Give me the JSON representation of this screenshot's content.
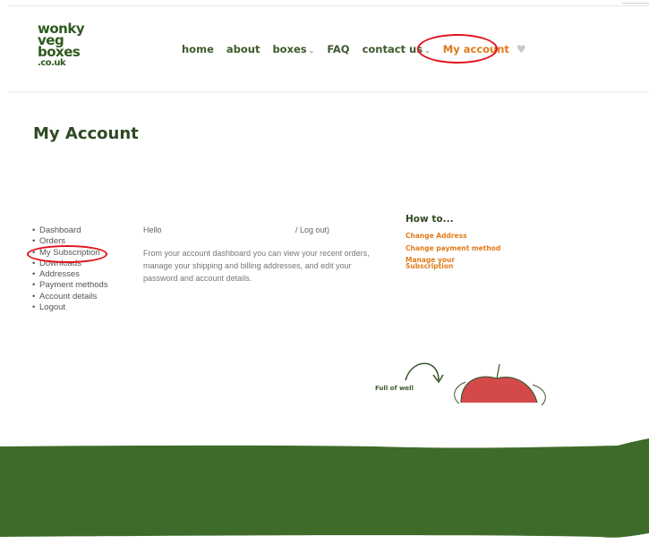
{
  "logo": {
    "line1": "wonky",
    "line2": "veg",
    "line3": "boxes",
    "tld": ".co.uk"
  },
  "nav": {
    "home": "home",
    "about": "about",
    "boxes": "boxes",
    "faq": "FAQ",
    "contact": "contact us",
    "account": "My account",
    "caret": "⌄",
    "heart": "♥"
  },
  "page": {
    "title": "My Account"
  },
  "account_menu": {
    "items": [
      "Dashboard",
      "Orders",
      "My Subscription",
      "Downloads",
      "Addresses",
      "Payment methods",
      "Account details",
      "Logout"
    ]
  },
  "dashboard": {
    "hello": "Hello",
    "logout": "/ Log out)",
    "intro": "From your account dashboard you can view your recent orders, manage your shipping and billing addresses, and edit your password and account details."
  },
  "howto": {
    "title": "How to...",
    "links": [
      "Change Address",
      "Change payment method",
      "Manage your Subscription"
    ]
  },
  "promo": {
    "text": "Full of well"
  },
  "colors": {
    "brand_green": "#3e6b2a",
    "accent_orange": "#e07b1a",
    "highlight_red": "#e0141c"
  }
}
